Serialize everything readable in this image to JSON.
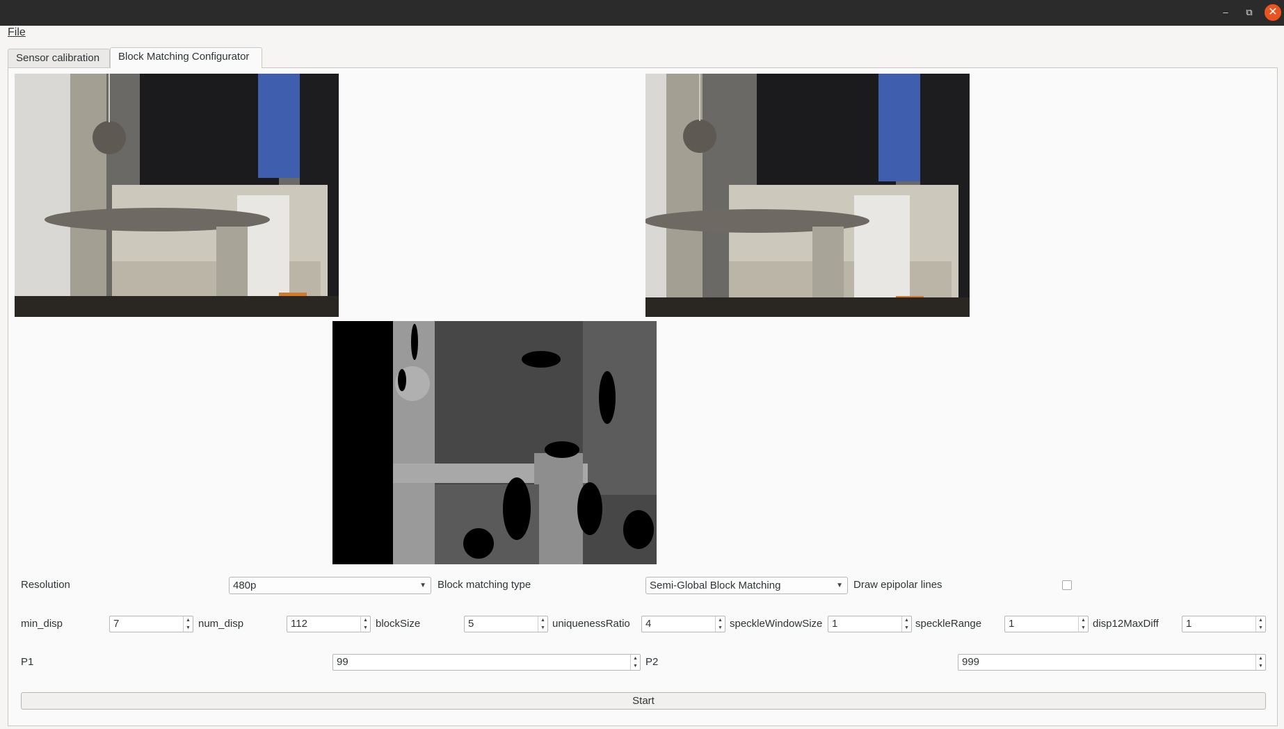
{
  "menubar": {
    "file": "File"
  },
  "tabs": [
    "Sensor calibration",
    "Block Matching Configurator"
  ],
  "window_controls": {
    "minimize": "–",
    "maximize": "⧉",
    "close": "✕"
  },
  "settings": {
    "resolution_label": "Resolution",
    "resolution_value": "480p",
    "block_matching_type_label": "Block matching type",
    "block_matching_type_value": "Semi-Global Block Matching",
    "draw_epipolar_label": "Draw epipolar lines",
    "draw_epipolar_checked": false,
    "min_disp_label": "min_disp",
    "min_disp_value": "7",
    "num_disp_label": "num_disp",
    "num_disp_value": "112",
    "blocksize_label": "blockSize",
    "blocksize_value": "5",
    "uniqueness_label": "uniquenessRatio",
    "uniqueness_value": "4",
    "speckle_window_label": "speckleWindowSize",
    "speckle_window_value": "1",
    "speckle_range_label": "speckleRange",
    "speckle_range_value": "1",
    "disp12_label": "disp12MaxDiff",
    "disp12_value": "1",
    "p1_label": "P1",
    "p1_value": "99",
    "p2_label": "P2",
    "p2_value": "999"
  },
  "start_label": "Start",
  "colors": {
    "accent_close": "#e95420",
    "titlebar": "#2b2b2b",
    "background": "#f6f5f4"
  }
}
